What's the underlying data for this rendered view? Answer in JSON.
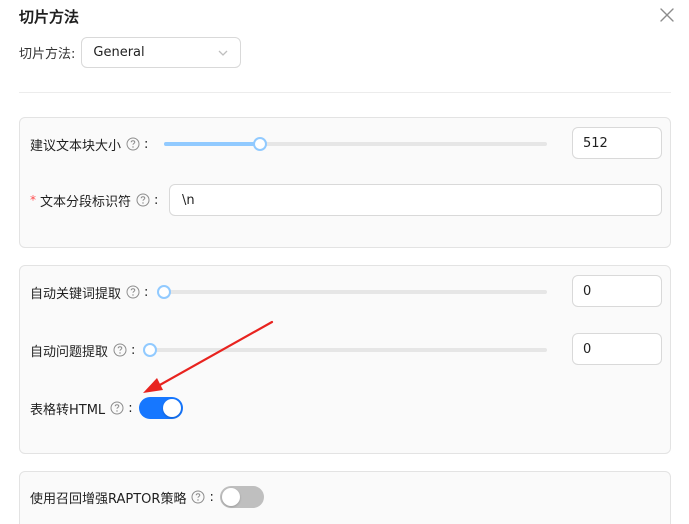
{
  "dialog": {
    "title": "切片方法",
    "close_icon": "close-icon"
  },
  "chunk_method": {
    "label": "切片方法:",
    "value": "General"
  },
  "chunk_size": {
    "label": "建议文本块大小",
    "value": "512",
    "slider_fraction": 0.25
  },
  "delimiter": {
    "required_mark": "*",
    "label": "文本分段标识符",
    "value": "\\n"
  },
  "auto_keywords": {
    "label": "自动关键词提取",
    "value": "0",
    "slider_fraction": 0
  },
  "auto_questions": {
    "label": "自动问题提取",
    "value": "0",
    "slider_fraction": 0
  },
  "table_to_html": {
    "label": "表格转HTML",
    "enabled": true
  },
  "raptor": {
    "label": "使用召回增强RAPTOR策略",
    "enabled": false
  },
  "colors": {
    "accent": "#1677ff",
    "slider": "#91caff",
    "arrow": "#e8231f",
    "required": "#ff4d4f"
  }
}
